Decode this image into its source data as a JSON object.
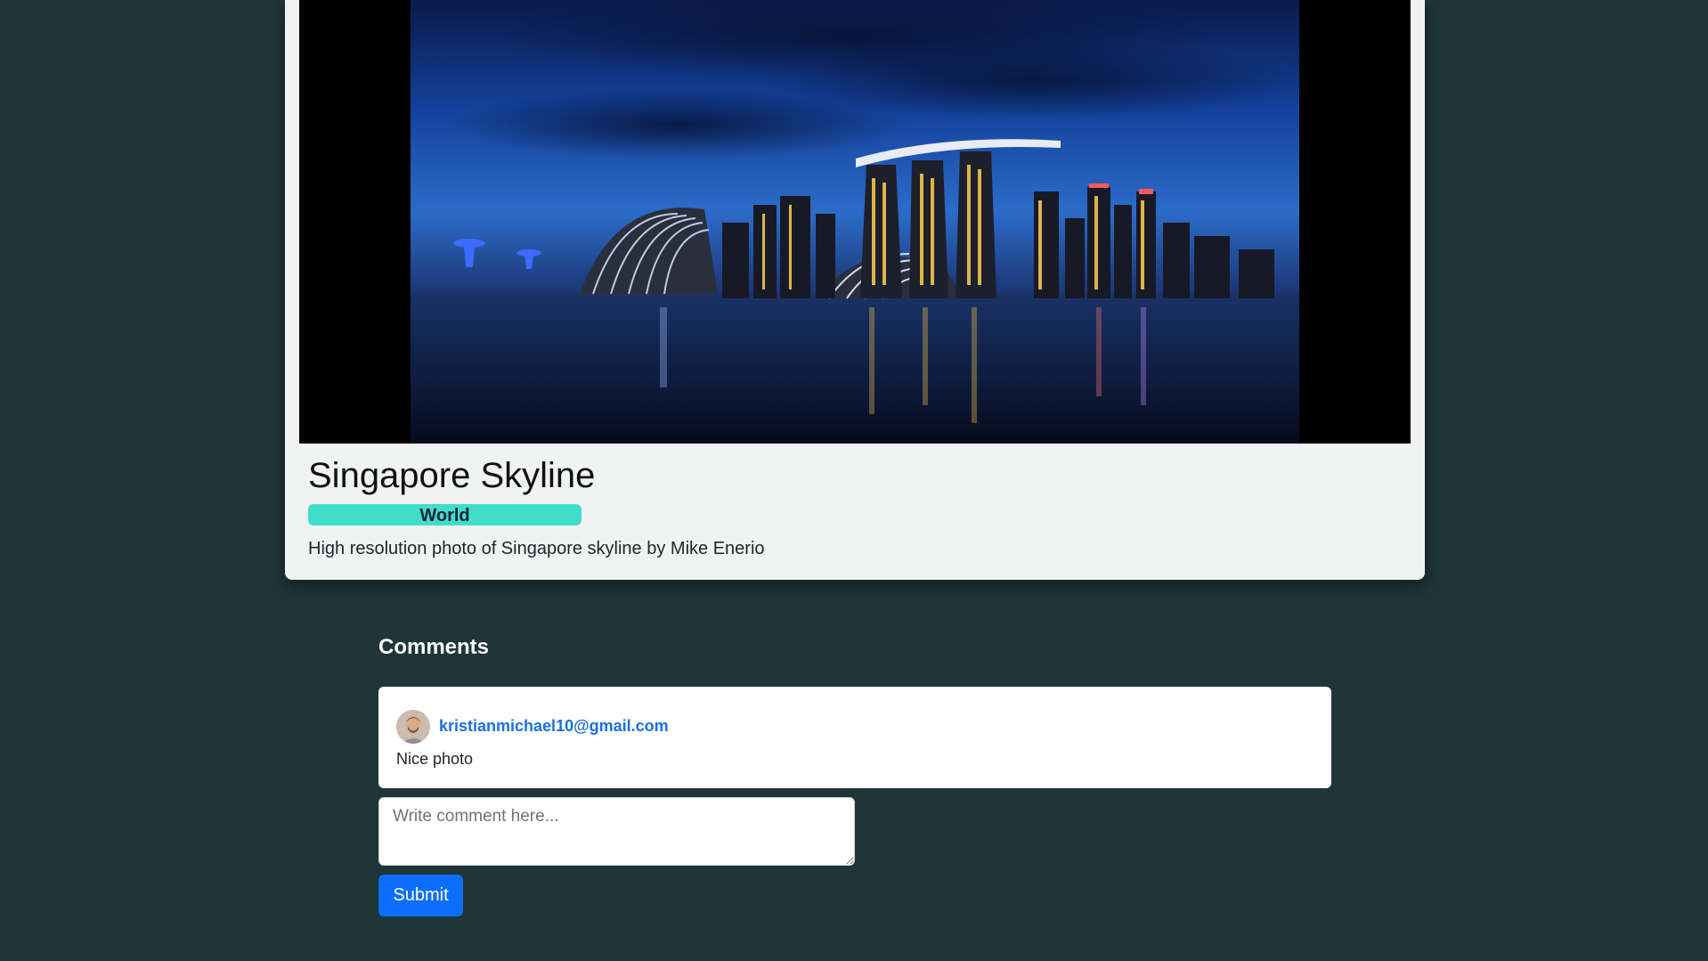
{
  "photo": {
    "title": "Singapore Skyline",
    "category": "World",
    "description": "High resolution photo of Singapore skyline by Mike Enerio"
  },
  "comments": {
    "heading": "Comments",
    "items": [
      {
        "author": "kristianmichael10@gmail.com",
        "text": "Nice photo"
      }
    ]
  },
  "comment_form": {
    "placeholder": "Write comment here...",
    "value": "",
    "submit_label": "Submit"
  },
  "colors": {
    "page_background": "#1f3538",
    "card_background": "#f1f3f3",
    "badge": "#40ddcb",
    "link": "#1a6fe6",
    "primary_button": "#0d6efd"
  }
}
